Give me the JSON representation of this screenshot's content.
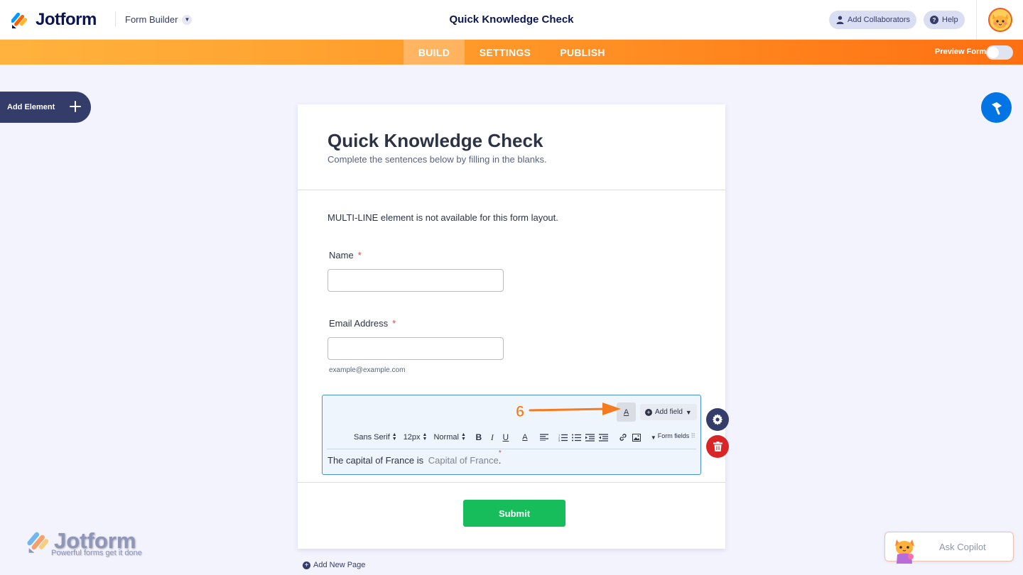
{
  "header": {
    "brand": "Jotform",
    "form_builder_label": "Form Builder",
    "form_title": "Quick Knowledge Check",
    "add_collaborators_label": "Add Collaborators",
    "help_label": "Help"
  },
  "nav": {
    "tabs": [
      {
        "label": "BUILD",
        "active": true
      },
      {
        "label": "SETTINGS",
        "active": false
      },
      {
        "label": "PUBLISH",
        "active": false
      }
    ],
    "preview_label": "Preview Form",
    "preview_enabled": false
  },
  "sidebar": {
    "add_element_label": "Add Element"
  },
  "form": {
    "title": "Quick Knowledge Check",
    "subtitle": "Complete the sentences below by filling in the blanks.",
    "notice": "MULTI-LINE element is not available for this form layout.",
    "fields": [
      {
        "label": "Name",
        "required_mark": "*",
        "value": ""
      },
      {
        "label": "Email Address",
        "required_mark": "*",
        "value": "",
        "sublabel": "example@example.com"
      }
    ],
    "fill_blank": {
      "sentence_prefix": "The capital of France is",
      "blank_placeholder": "Capital of France",
      "blank_required_mark": "*",
      "sentence_suffix": "."
    },
    "submit_label": "Submit",
    "add_page_label": "Add New Page"
  },
  "editor_toolbar": {
    "annotation_step": "6",
    "add_field_label": "Add field",
    "font_family": "Sans Serif",
    "font_size": "12px",
    "paragraph_style": "Normal",
    "form_fields_label": "Form fields"
  },
  "watermark": {
    "brand": "Jotform",
    "tagline": "Powerful forms get it done"
  },
  "copilot": {
    "label": "Ask Copilot"
  },
  "colors": {
    "brand_navy": "#0a1551",
    "nav_orange_start": "#ffb33e",
    "nav_orange_end": "#ff6f12",
    "submit_green": "#18bd5b",
    "delete_red": "#d92525",
    "designer_blue": "#0075e3",
    "annotation_orange": "#f47b20"
  }
}
